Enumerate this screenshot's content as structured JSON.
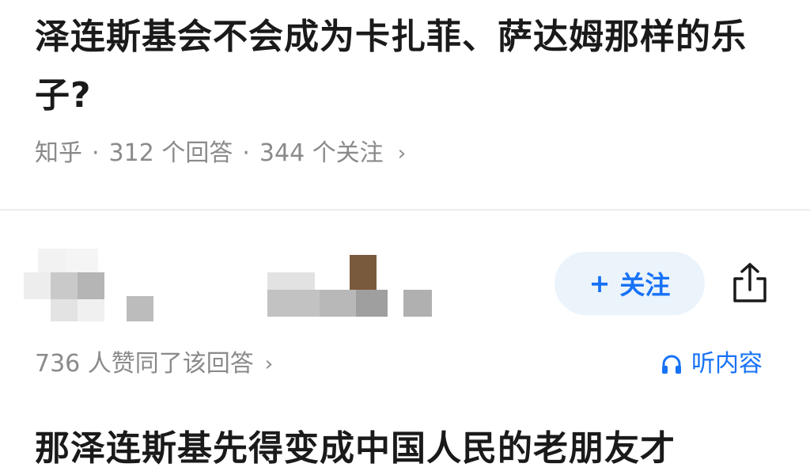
{
  "question": {
    "title": "泽连斯基会不会成为卡扎菲、萨达姆那样的乐子?",
    "source": "知乎",
    "separator": "·",
    "answers": "312 个回答",
    "follows": "344 个关注",
    "chevron": "›"
  },
  "answer": {
    "follow_label": "关注",
    "follow_plus": "+",
    "share_icon": "share-icon",
    "likes": "736 人赞同了该回答",
    "chevron": "›",
    "listen_icon": "headphones-icon",
    "listen_label": "听内容",
    "text": "那泽连斯基先得变成中国人民的老朋友才"
  },
  "colors": {
    "accent": "#1772f6",
    "follow_bg": "#ebf3fb",
    "meta_text": "#8a8a8a",
    "title_text": "#1a1a1a"
  }
}
